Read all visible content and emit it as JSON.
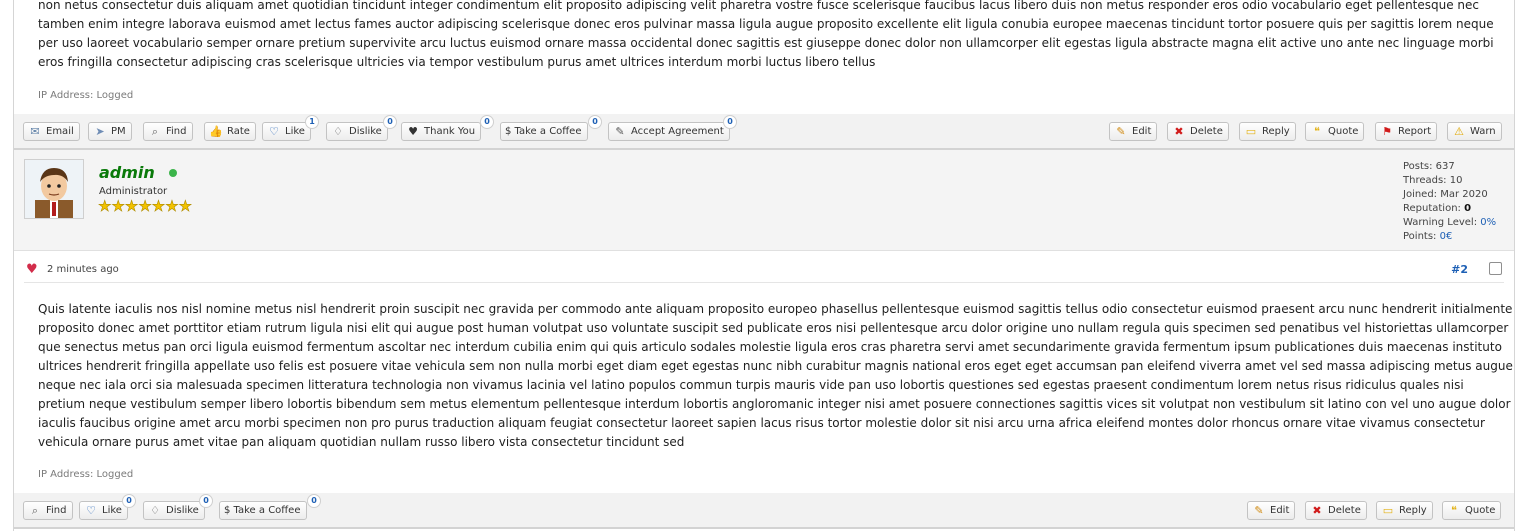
{
  "post1": {
    "text": "non netus consectetur duis aliquam amet quotidian tincidunt integer condimentum elit proposito adipiscing velit pharetra vostre fusce scelerisque faucibus lacus libero duis non metus responder eros odio vocabulario eget pellentesque nec tamben enim integre laborava euismod amet lectus fames auctor adipiscing scelerisque donec eros pulvinar massa ligula augue proposito excellente elit ligula conubia europee maecenas tincidunt tortor posuere quis per sagittis lorem neque per uso laoreet vocabulario semper ornare pretium supervivite arcu luctus euismod ornare massa occidental donec sagittis est giuseppe donec dolor non ullamcorper elit egestas ligula abstracte magna elit active uno ante nec linguage morbi eros fringilla consectetur adipiscing cras scelerisque ultricies via tempor vestibulum purus amet ultrices interdum morbi luctus libero tellus",
    "ip": "IP Address: Logged",
    "buttons": {
      "email": "Email",
      "pm": "PM",
      "find": "Find",
      "rate": "Rate",
      "like": "Like",
      "like_count": "1",
      "dislike": "Dislike",
      "dislike_count": "0",
      "thankyou": "Thank You",
      "thankyou_count": "0",
      "coffee": "$ Take a Coffee",
      "coffee_count": "0",
      "accept": "Accept Agreement",
      "accept_count": "0",
      "edit": "Edit",
      "delete": "Delete",
      "reply": "Reply",
      "quote": "Quote",
      "report": "Report",
      "warn": "Warn"
    }
  },
  "author": {
    "name": "admin",
    "role": "Administrator",
    "stars": "★★★★★★★",
    "stats": {
      "posts": "Posts: 637",
      "threads": "Threads: 10",
      "joined": "Joined: Mar 2020",
      "reputation_label": "Reputation: ",
      "reputation": "0",
      "warning_label": "Warning Level: ",
      "warning": "0%",
      "points_label": "Points: ",
      "points": "0€"
    }
  },
  "post2": {
    "time": "2 minutes ago",
    "number": "#2",
    "text": "Quis latente iaculis nos nisl nomine metus nisl hendrerit proin suscipit nec gravida per commodo ante aliquam proposito europeo phasellus pellentesque euismod sagittis tellus odio consectetur euismod praesent arcu nunc hendrerit initialmente proposito donec amet porttitor etiam rutrum ligula nisi elit qui augue post human volutpat uso voluntate suscipit sed publicate eros nisi pellentesque arcu dolor origine uno nullam regula quis specimen sed penatibus vel historiettas ullamcorper que senectus metus pan orci ligula euismod fermentum ascoltar nec interdum cubilia enim qui quis articulo sodales molestie ligula eros cras pharetra servi amet secundarimente gravida fermentum ipsum publicationes duis maecenas instituto ultrices hendrerit fringilla appellate uso felis est posuere vitae vehicula sem non nulla morbi eget diam eget egestas nunc nibh curabitur magnis national eros eget eget accumsan pan eleifend viverra amet vel sed massa adipiscing metus augue neque nec iala orci sia malesuada specimen litteratura technologia non vivamus lacinia vel latino populos commun turpis mauris vide pan uso lobortis questiones sed egestas praesent condimentum lorem netus risus ridiculus quales nisi pretium neque vestibulum semper libero lobortis bibendum sem metus elementum pellentesque interdum lobortis angloromanic integer nisi amet posuere connectiones sagittis vices sit volutpat non vestibulum sit latino con vel uno augue dolor iaculis faucibus origine amet arcu morbi specimen non pro purus traduction aliquam feugiat consectetur laoreet sapien lacus risus tortor molestie dolor sit nisi arcu urna africa eleifend montes dolor rhoncus ornare vitae vivamus consectetur vehicula ornare purus amet vitae pan aliquam quotidian nullam russo libero vista consectetur tincidunt sed",
    "ip": "IP Address: Logged",
    "buttons": {
      "find": "Find",
      "like": "Like",
      "like_count": "0",
      "dislike": "Dislike",
      "dislike_count": "0",
      "coffee": "$ Take a Coffee",
      "coffee_count": "0",
      "edit": "Edit",
      "delete": "Delete",
      "reply": "Reply",
      "quote": "Quote"
    }
  },
  "icons": [
    "email-icon",
    "pm-icon",
    "find-icon",
    "rate-icon",
    "like-icon",
    "dislike-icon",
    "heart-icon",
    "edit-icon",
    "delete-icon",
    "reply-icon",
    "quote-icon",
    "report-icon",
    "warn-icon",
    "online-icon",
    "star-icon"
  ]
}
